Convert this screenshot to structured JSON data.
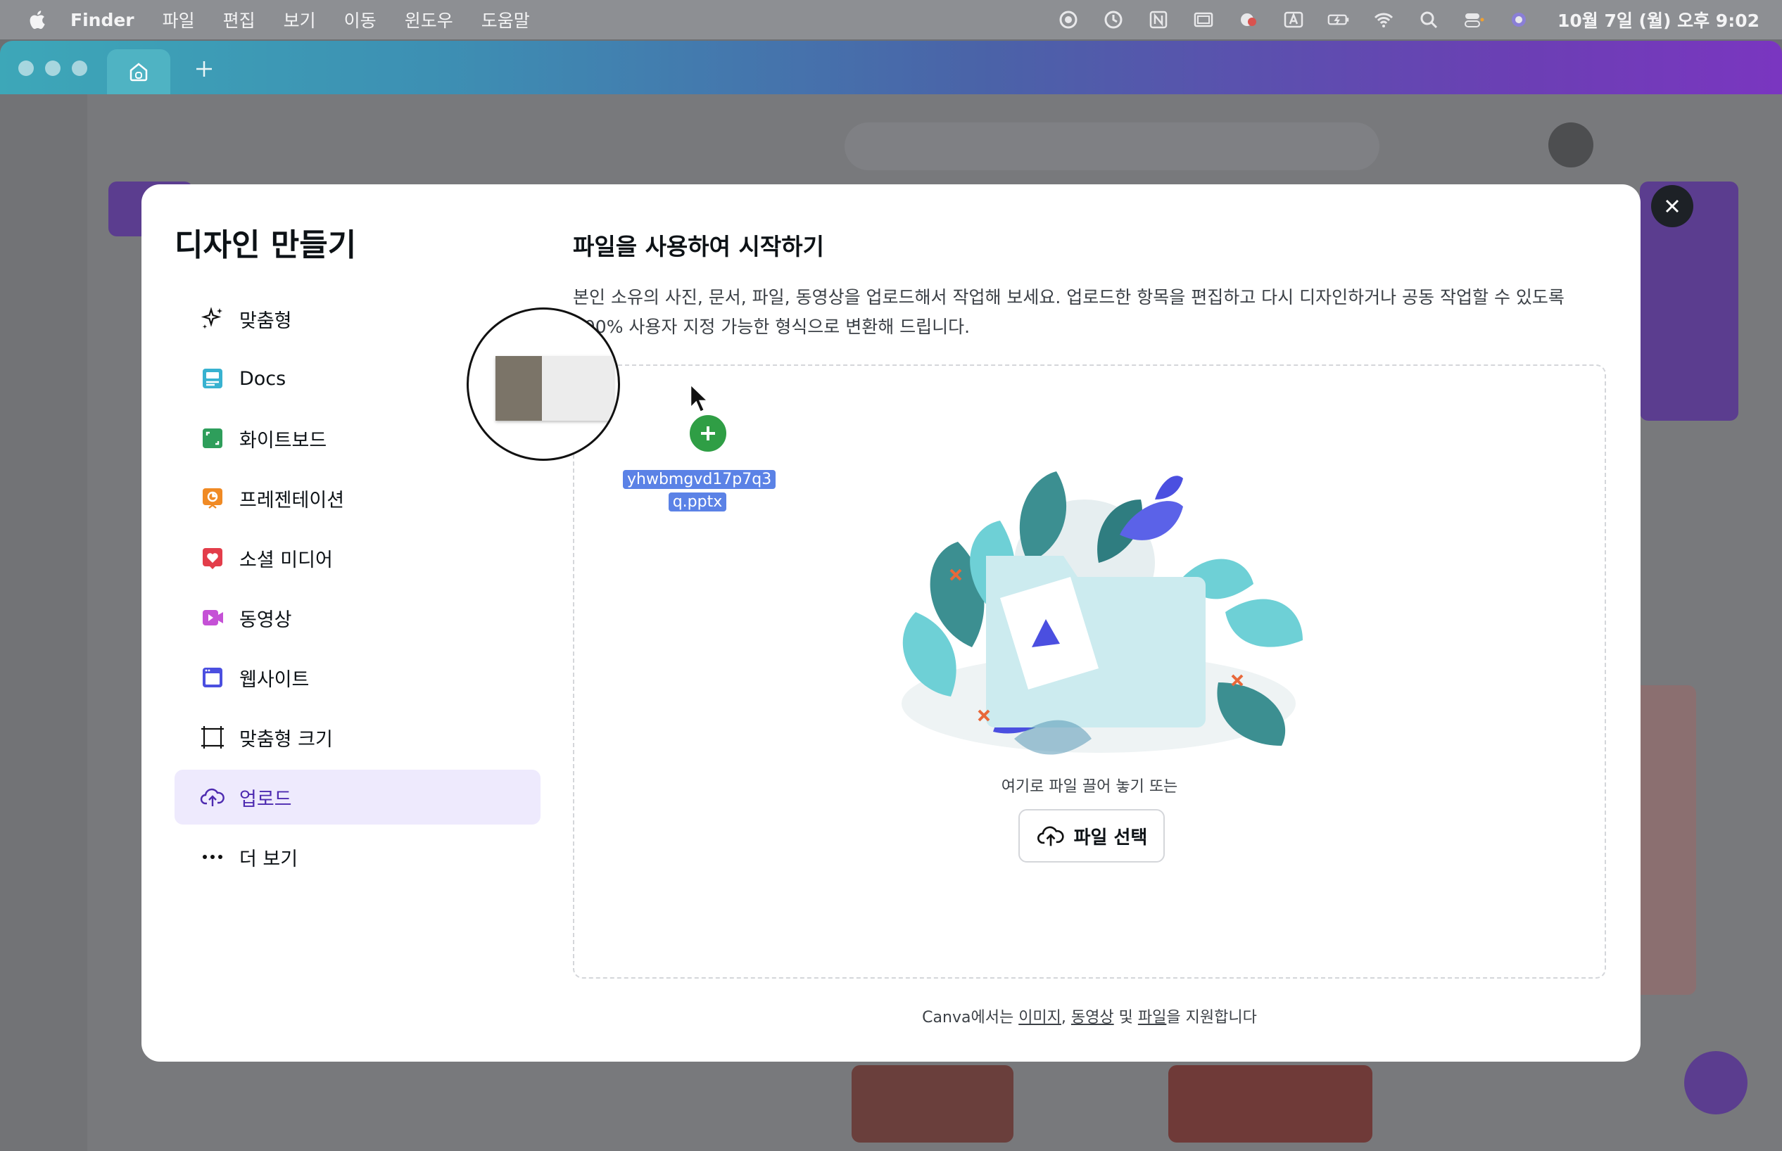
{
  "menubar": {
    "app": "Finder",
    "items": [
      "파일",
      "편집",
      "보기",
      "이동",
      "윈도우",
      "도움말"
    ],
    "clock": "10월 7일 (월) 오후 9:02"
  },
  "modal": {
    "title": "디자인 만들기",
    "nav": [
      {
        "label": "맞춤형",
        "icon": "sparkle-icon"
      },
      {
        "label": "Docs",
        "icon": "docs-icon"
      },
      {
        "label": "화이트보드",
        "icon": "whiteboard-icon"
      },
      {
        "label": "프레젠테이션",
        "icon": "presentation-icon"
      },
      {
        "label": "소셜 미디어",
        "icon": "heart-icon"
      },
      {
        "label": "동영상",
        "icon": "video-icon"
      },
      {
        "label": "웹사이트",
        "icon": "website-icon"
      },
      {
        "label": "맞춤형 크기",
        "icon": "resize-icon"
      },
      {
        "label": "업로드",
        "icon": "cloud-upload-icon"
      },
      {
        "label": "더 보기",
        "icon": "more-dots-icon"
      }
    ],
    "active_nav": "업로드",
    "upload": {
      "title": "파일을 사용하여 시작하기",
      "description": "본인 소유의 사진, 문서, 파일, 동영상을 업로드해서 작업해 보세요. 업로드한 항목을 편집하고 다시 디자인하거나 공동 작업할 수 있도록 100% 사용자 지정 가능한 형식으로 변환해 드립니다.",
      "drop_hint": "여기로 파일 끌어 놓기 또는",
      "choose_button": "파일 선택",
      "dragged_file_line1": "yhwbmgvd17p7q3",
      "dragged_file_line2": "q.pptx",
      "footer": {
        "prefix": "Canva에서는 ",
        "link_images": "이미지",
        "sep": ", ",
        "link_videos": "동영상",
        "mid": " 및 ",
        "link_files": "파일",
        "suffix": "을 지원합니다"
      }
    }
  },
  "colors": {
    "accent_purple": "#4d2ab0",
    "active_bg": "#eeeafd",
    "file_highlight": "#5b82e6",
    "plus_green": "#2f9e45"
  }
}
